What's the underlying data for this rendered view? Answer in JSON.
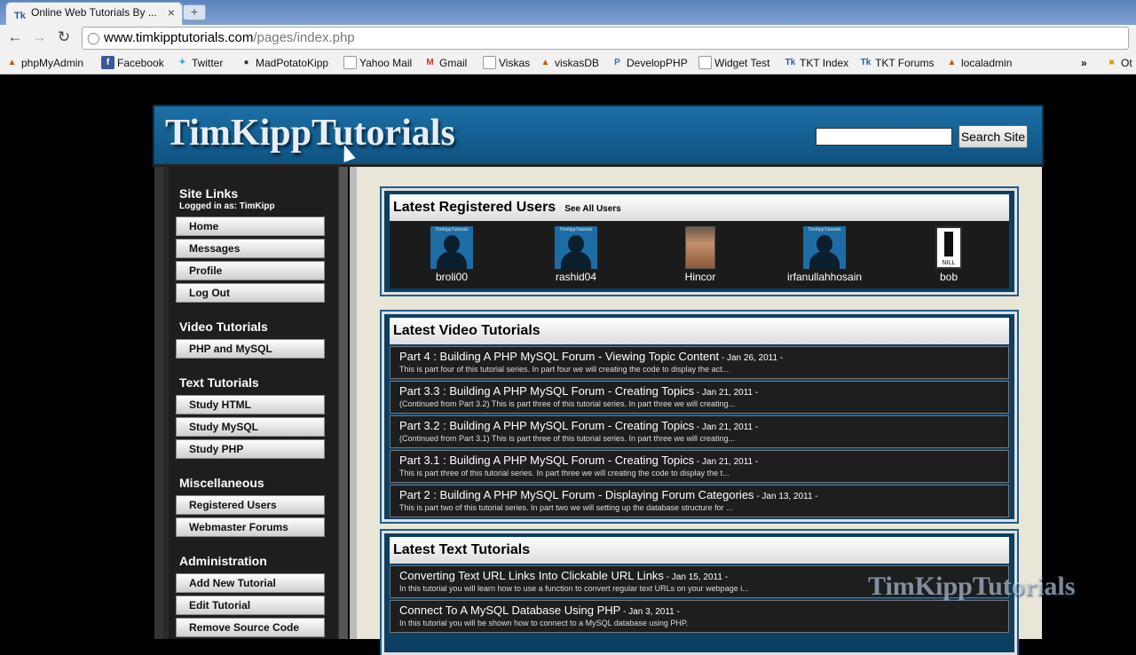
{
  "browser": {
    "tab_title": "Online Web Tutorials By ...",
    "tab_favicon": "Tk",
    "url_host": "www.timkipptutorials.com",
    "url_path": "/pages/index.php",
    "bookmarks": [
      {
        "label": "phpMyAdmin",
        "icon": "pma-icon"
      },
      {
        "label": "Facebook",
        "icon": "facebook-icon"
      },
      {
        "label": "Twitter",
        "icon": "twitter-icon"
      },
      {
        "label": "MadPotatoKipp",
        "icon": "person-icon"
      },
      {
        "label": "Yahoo Mail",
        "icon": "page-icon"
      },
      {
        "label": "Gmail",
        "icon": "gmail-icon"
      },
      {
        "label": "Viskas",
        "icon": "page-icon"
      },
      {
        "label": "viskasDB",
        "icon": "pma-icon"
      },
      {
        "label": "DevelopPHP",
        "icon": "developphp-icon"
      },
      {
        "label": "Widget Test",
        "icon": "page-icon"
      },
      {
        "label": "TKT Index",
        "icon": "tkt-icon"
      },
      {
        "label": "TKT Forums",
        "icon": "tkt-icon"
      },
      {
        "label": "localadmin",
        "icon": "pma-icon"
      }
    ],
    "overflow": "»",
    "other_bookmarks": "Ot"
  },
  "site": {
    "logo": "TimKippTutorials",
    "search_button": "Search Site",
    "search_value": ""
  },
  "sidebar": {
    "site_links_title": "Site Links",
    "logged_in": "Logged in as: TimKipp",
    "site_links": [
      "Home",
      "Messages",
      "Profile",
      "Log Out"
    ],
    "video_title": "Video Tutorials",
    "video_links": [
      "PHP and MySQL"
    ],
    "text_title": "Text Tutorials",
    "text_links": [
      "Study HTML",
      "Study MySQL",
      "Study PHP"
    ],
    "misc_title": "Miscellaneous",
    "misc_links": [
      "Registered Users",
      "Webmaster Forums"
    ],
    "admin_title": "Administration",
    "admin_links": [
      "Add New Tutorial",
      "Edit Tutorial",
      "Remove Source Code"
    ]
  },
  "users_panel": {
    "title": "Latest Registered Users",
    "see_all": "See All Users",
    "avatar_label": "TimKippTutorials",
    "nill_label": "NILL",
    "users": [
      "broli00",
      "rashid04",
      "Hincor",
      "irfanullahhosain",
      "bob"
    ]
  },
  "video_panel": {
    "title": "Latest Video Tutorials",
    "items": [
      {
        "title": "Part 4 : Building A PHP MySQL Forum - Viewing Topic Content",
        "date": " - Jan 26, 2011 -",
        "desc": "This is part four of this tutorial series. In part four we will creating the code to display the act..."
      },
      {
        "title": "Part 3.3 : Building A PHP MySQL Forum - Creating Topics",
        "date": " - Jan 21, 2011 -",
        "desc": "(Continued from Part 3.2) This is part three of this tutorial series. In part three we will creating..."
      },
      {
        "title": "Part 3.2 : Building A PHP MySQL Forum - Creating Topics",
        "date": " - Jan 21, 2011 -",
        "desc": "(Continued from Part 3.1) This is part three of this tutorial series. In part three we will creating..."
      },
      {
        "title": "Part 3.1 : Building A PHP MySQL Forum - Creating Topics",
        "date": " - Jan 21, 2011 -",
        "desc": "This is part three of this tutorial series. In part three we will creating the code to display the t..."
      },
      {
        "title": "Part 2 : Building A PHP MySQL Forum - Displaying Forum Categories",
        "date": " - Jan 13, 2011 -",
        "desc": "This is part two of this tutorial series. In part two we will setting up the database structure for ..."
      }
    ]
  },
  "text_panel": {
    "title": "Latest Text Tutorials",
    "items": [
      {
        "title": "Converting Text URL Links Into Clickable URL Links",
        "date": " - Jan 15, 2011 -",
        "desc": "In this tutorial you will learn how to use a function to convert regular text URLs on your webpage i..."
      },
      {
        "title": "Connect To A MySQL Database Using PHP",
        "date": " - Jan 3, 2011 -",
        "desc": "In this tutorial you will be shown how to connect to a MySQL database using PHP."
      }
    ]
  },
  "watermark": "TimKippTutorials"
}
